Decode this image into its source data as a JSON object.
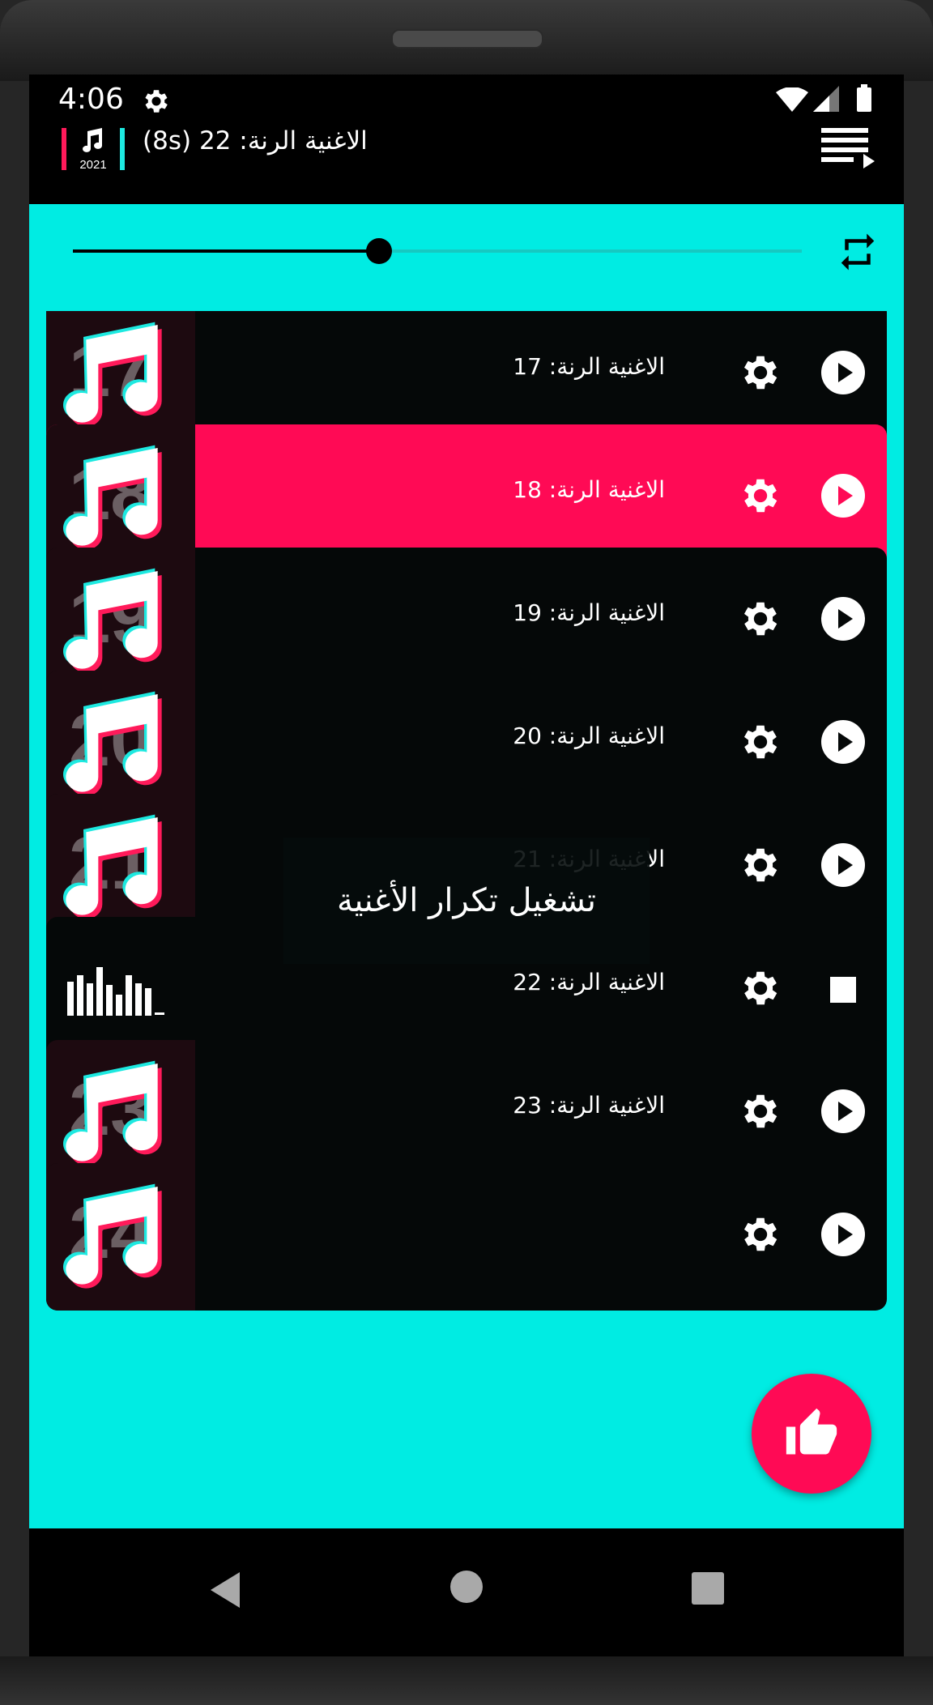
{
  "status": {
    "time": "4:06"
  },
  "app": {
    "logo_year": "2021",
    "now_playing": "الاغنية الرنة: 22 (8s)"
  },
  "player": {
    "progress": 0.42
  },
  "rows": [
    {
      "number": "17",
      "title": "الاغنية الرنة: 17",
      "state": "idle"
    },
    {
      "number": "18",
      "title": "الاغنية الرنة: 18",
      "state": "selected"
    },
    {
      "number": "19",
      "title": "الاغنية الرنة: 19",
      "state": "idle"
    },
    {
      "number": "20",
      "title": "الاغنية الرنة: 20",
      "state": "idle"
    },
    {
      "number": "21",
      "title": "الاغنية الرنة: 21",
      "state": "idle"
    },
    {
      "number": "22",
      "title": "الاغنية الرنة: 22",
      "state": "playing"
    },
    {
      "number": "23",
      "title": "الاغنية الرنة: 23",
      "state": "idle"
    },
    {
      "number": "24",
      "title": "",
      "state": "idle"
    }
  ],
  "toast": {
    "text": "تشغيل تكرار الأغنية"
  },
  "icons": {
    "settings": "gear-icon",
    "play": "play-icon",
    "stop": "stop-icon",
    "repeat": "repeat-icon",
    "playlist": "playlist-icon",
    "like": "thumbs-up-icon"
  },
  "colors": {
    "accent": "#ff0a55",
    "teal": "#00ece3",
    "row": "#050808"
  }
}
